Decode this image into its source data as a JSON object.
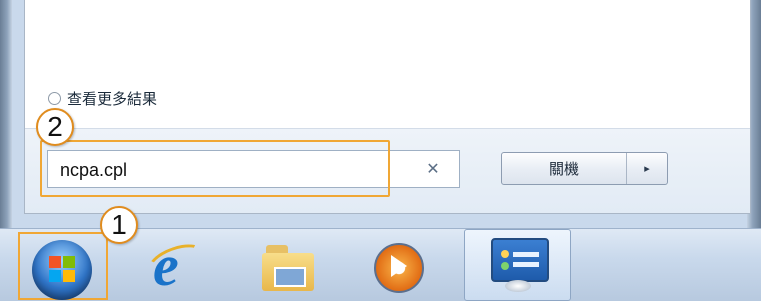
{
  "start_menu": {
    "see_more_label": "查看更多結果",
    "search": {
      "value": "ncpa.cpl",
      "clear_icon": "✕"
    },
    "shutdown": {
      "label": "關機",
      "arrow_icon": "▸"
    }
  },
  "callouts": {
    "step1": "1",
    "step2": "2"
  },
  "taskbar": {
    "icons": [
      "windows-start-orb",
      "internet-explorer-icon",
      "file-explorer-icon",
      "media-player-icon",
      "control-panel-icon"
    ]
  },
  "colors": {
    "highlight": "#f0a735",
    "panel": "#ffffff",
    "taskbar": "#c9d9ec"
  }
}
